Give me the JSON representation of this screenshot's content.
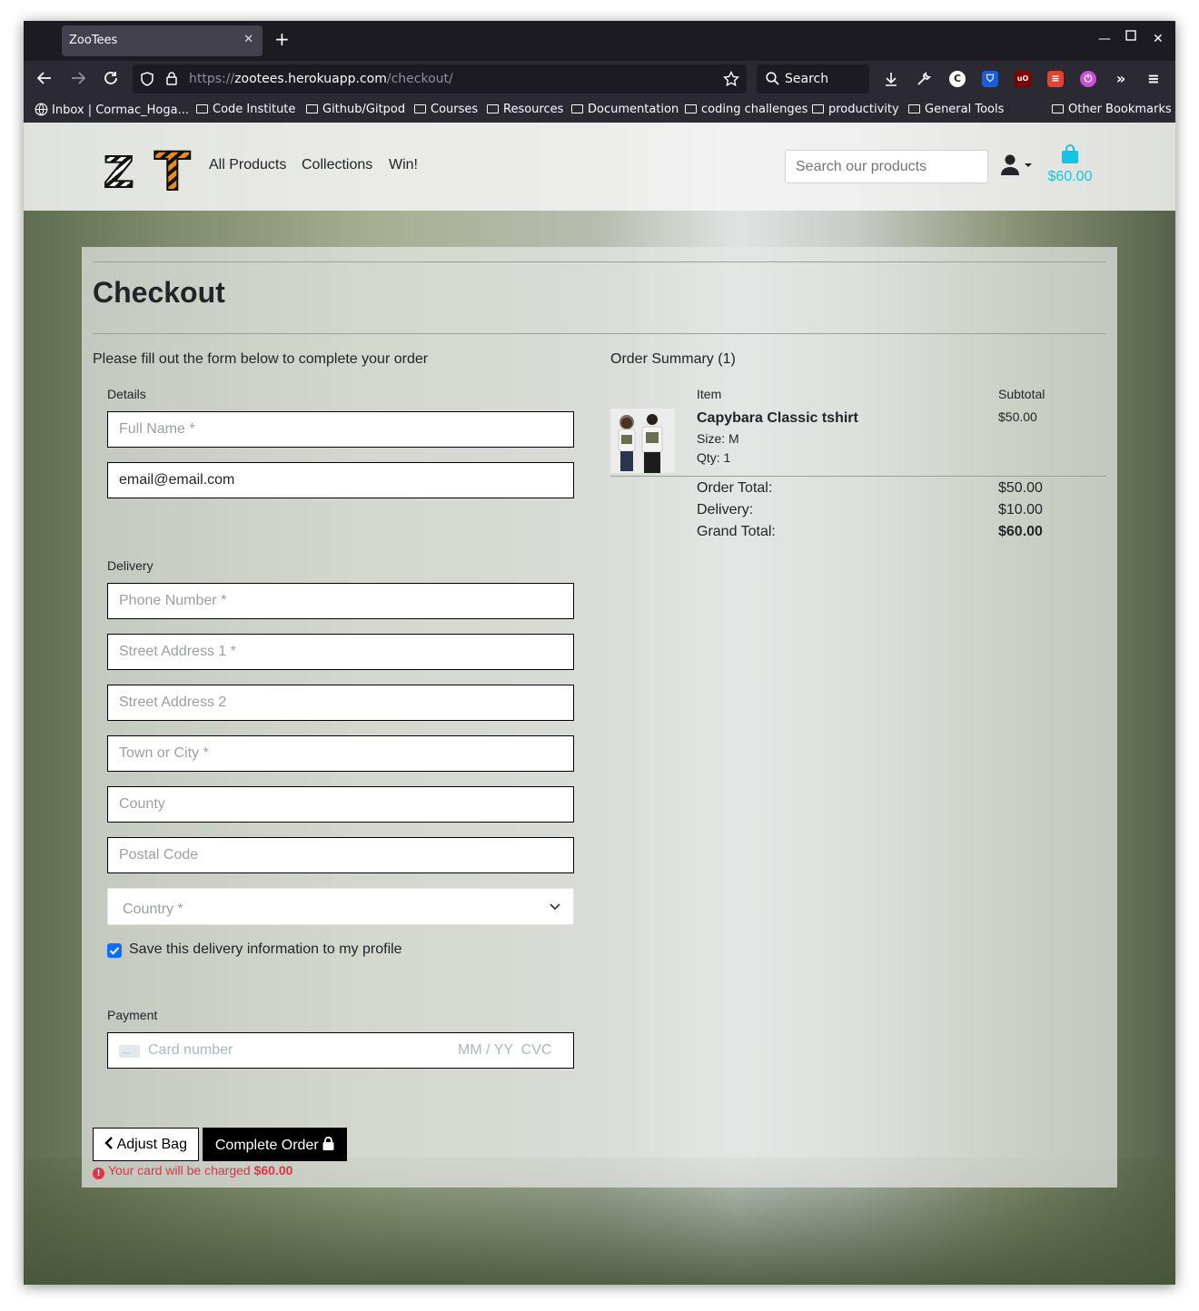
{
  "browser": {
    "tab_title": "ZooTees",
    "url_scheme": "https://",
    "url_host": "zootees.herokuapp.com",
    "url_path": "/checkout/",
    "search_label": "Search",
    "bookmarks": [
      "Inbox | Cormac_Hoga...",
      "Code Institute",
      "Github/Gitpod",
      "Courses",
      "Resources",
      "Documentation",
      "coding challenges",
      "productivity",
      "General Tools",
      "Other Bookmarks"
    ]
  },
  "site": {
    "logo_z": "Z",
    "logo_t": "T",
    "nav": [
      "All Products",
      "Collections",
      "Win!"
    ],
    "search_placeholder": "Search our products",
    "bag_total": "$60.00",
    "accent_color": "#17c3e3"
  },
  "checkout": {
    "title": "Checkout",
    "intro": "Please fill out the form below to complete your order",
    "details_label": "Details",
    "full_name_placeholder": "Full Name *",
    "email_value": "email@email.com",
    "delivery_label": "Delivery",
    "phone_placeholder": "Phone Number *",
    "street1_placeholder": "Street Address 1 *",
    "street2_placeholder": "Street Address 2",
    "town_placeholder": "Town or City *",
    "county_placeholder": "County",
    "postcode_placeholder": "Postal Code",
    "country_placeholder": "Country *",
    "save_info_label": "Save this delivery information to my profile",
    "save_info_checked": true,
    "payment_label": "Payment",
    "card_number_placeholder": "Card number",
    "card_expiry_cvc_placeholder": "MM / YY  CVC",
    "adjust_bag_label": "Adjust Bag",
    "complete_order_label": "Complete Order",
    "charge_text": "Your card will be charged",
    "charge_amount": "$60.00"
  },
  "summary": {
    "title": "Order Summary (1)",
    "col_item": "Item",
    "col_subtotal": "Subtotal",
    "product_name": "Capybara Classic tshirt",
    "product_size": "Size: M",
    "product_qty": "Qty: 1",
    "product_subtotal": "$50.00",
    "order_total_label": "Order Total:",
    "order_total": "$50.00",
    "delivery_label": "Delivery:",
    "delivery": "$10.00",
    "grand_total_label": "Grand Total:",
    "grand_total": "$60.00"
  }
}
